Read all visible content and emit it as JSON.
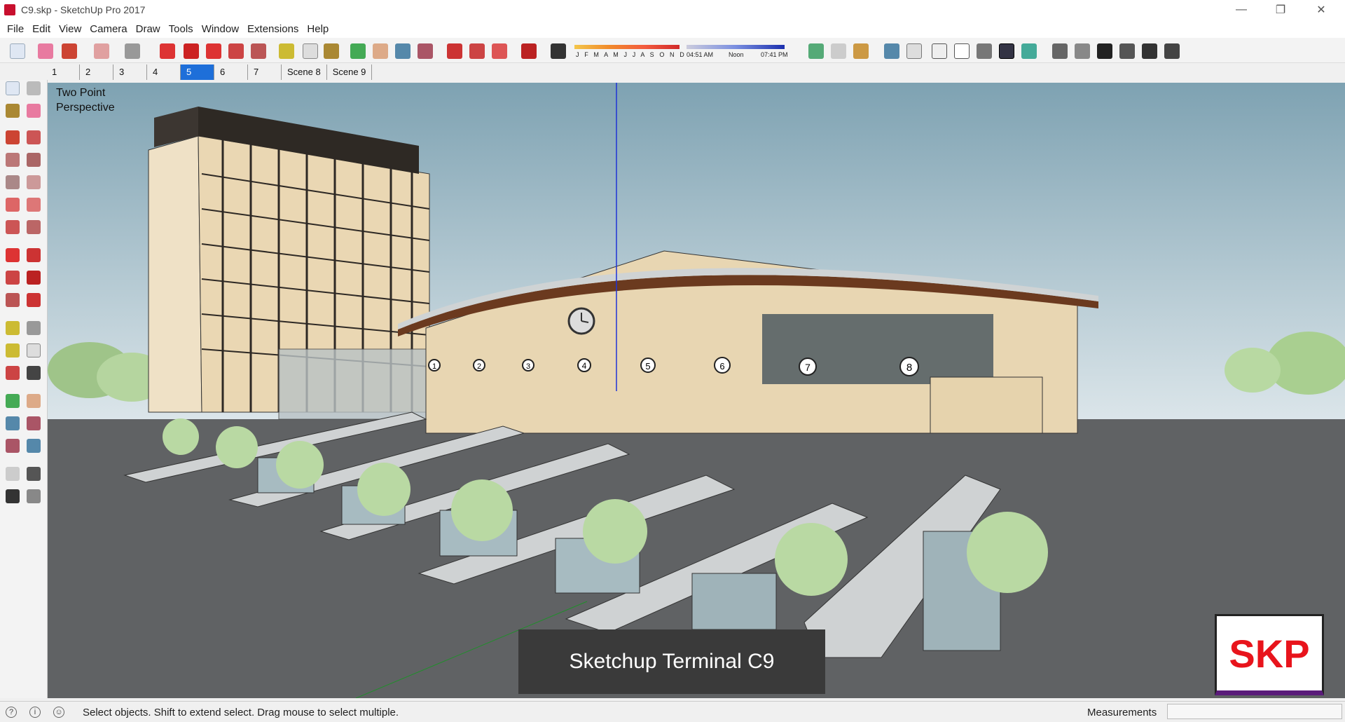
{
  "window": {
    "title": "C9.skp - SketchUp Pro 2017"
  },
  "menu": [
    "File",
    "Edit",
    "View",
    "Camera",
    "Draw",
    "Tools",
    "Window",
    "Extensions",
    "Help"
  ],
  "shadow": {
    "months": "J F M A M J J A S O N D",
    "time_start": "04:51 AM",
    "time_mid": "Noon",
    "time_end": "07:41 PM"
  },
  "scenes": [
    {
      "label": "1",
      "active": false
    },
    {
      "label": "2",
      "active": false
    },
    {
      "label": "3",
      "active": false
    },
    {
      "label": "4",
      "active": false
    },
    {
      "label": "5",
      "active": true
    },
    {
      "label": "6",
      "active": false
    },
    {
      "label": "7",
      "active": false
    },
    {
      "label": "Scene 8",
      "active": false
    },
    {
      "label": "Scene 9",
      "active": false
    }
  ],
  "viewport": {
    "camera_label_line1": "Two Point",
    "camera_label_line2": "Perspective",
    "bay_numbers": [
      "1",
      "2",
      "3",
      "4",
      "5",
      "6",
      "7",
      "8"
    ],
    "caption": "Sketchup Terminal C9",
    "logo_text": "SKP"
  },
  "status": {
    "message": "Select objects. Shift to extend select. Drag mouse to select multiple.",
    "measurements_label": "Measurements",
    "measurements_value": ""
  },
  "colors": {
    "accent": "#1e6fd9",
    "logo_red": "#e8141c",
    "sky": "#8aaab8",
    "ground": "#5f6163"
  }
}
